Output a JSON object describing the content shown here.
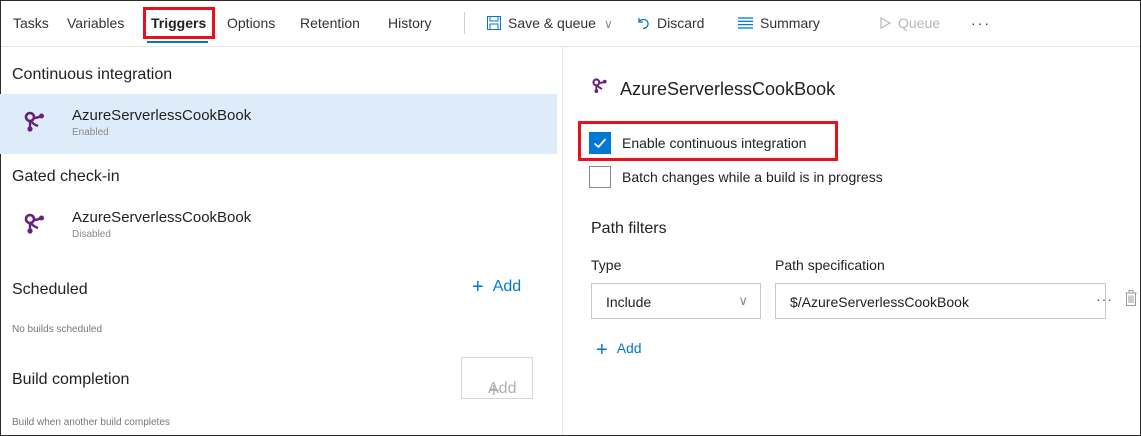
{
  "tabs": [
    {
      "label": "Tasks"
    },
    {
      "label": "Variables"
    },
    {
      "label": "Triggers"
    },
    {
      "label": "Options"
    },
    {
      "label": "Retention"
    },
    {
      "label": "History"
    }
  ],
  "toolbar": {
    "save_queue": "Save & queue",
    "discard": "Discard",
    "summary": "Summary",
    "queue": "Queue",
    "more": "···"
  },
  "left": {
    "continuous_integration": {
      "title": "Continuous integration",
      "item_name": "AzureServerlessCookBook",
      "item_status": "Enabled"
    },
    "gated_checkin": {
      "title": "Gated check-in",
      "item_name": "AzureServerlessCookBook",
      "item_status": "Disabled"
    },
    "scheduled": {
      "title": "Scheduled",
      "add_label": "Add",
      "note": "No builds scheduled"
    },
    "build_completion": {
      "title": "Build completion",
      "add_label": "Add",
      "note": "Build when another build completes"
    }
  },
  "right": {
    "repo_title": "AzureServerlessCookBook",
    "enable_ci": {
      "label": "Enable continuous integration",
      "checked": true
    },
    "batch_changes": {
      "label": "Batch changes while a build is in progress",
      "checked": false
    },
    "path_filters": {
      "title": "Path filters",
      "type_label": "Type",
      "path_label": "Path specification",
      "type_value": "Include",
      "path_value": "$/AzureServerlessCookBook",
      "more": "···",
      "add_label": "Add"
    }
  },
  "colors": {
    "accent": "#0078d4",
    "highlight_box": "#e8111b",
    "selected_row": "#deecf9",
    "repo_icon": "#68217a"
  },
  "icons": {
    "repo": "tfvc-repo-icon",
    "save": "floppy-disk-icon",
    "discard": "undo-icon",
    "summary": "list-icon",
    "queue": "play-icon",
    "chevron": "chevron-down-icon",
    "trash": "trash-icon"
  }
}
